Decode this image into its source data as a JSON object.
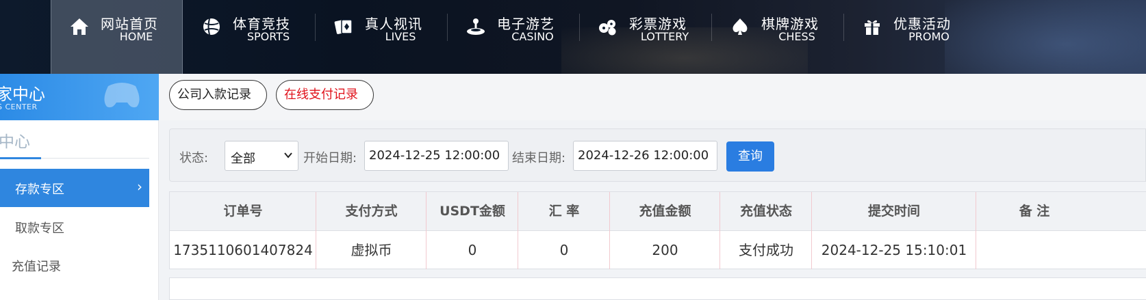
{
  "nav": [
    {
      "cn": "网站首页",
      "en": "HOME",
      "icon": "home-icon"
    },
    {
      "cn": "体育竞技",
      "en": "SPORTS",
      "icon": "ball-icon"
    },
    {
      "cn": "真人视讯",
      "en": "LIVES",
      "icon": "cards-icon"
    },
    {
      "cn": "电子游艺",
      "en": "CASINO",
      "icon": "joystick-icon"
    },
    {
      "cn": "彩票游戏",
      "en": "LOTTERY",
      "icon": "lottery-balls-icon"
    },
    {
      "cn": "棋牌游戏",
      "en": "CHESS",
      "icon": "spade-icon"
    },
    {
      "cn": "优惠活动",
      "en": "PROMO",
      "icon": "gift-icon"
    }
  ],
  "sidebar": {
    "banner_title": "家中心",
    "banner_sub": "S CENTER",
    "section_title": "中心",
    "items": [
      {
        "label": "存款专区"
      },
      {
        "label": "取款专区"
      },
      {
        "label": "充值记录"
      }
    ]
  },
  "tabs": [
    {
      "label": "公司入款记录"
    },
    {
      "label": "在线支付记录"
    }
  ],
  "filter": {
    "status_label": "状态:",
    "status_value": "全部",
    "start_label": "开始日期:",
    "start_value": "2024-12-25 12:00:00",
    "end_label": "结束日期:",
    "end_value": "2024-12-26 12:00:00",
    "query_label": "查询"
  },
  "table": {
    "headers": [
      "订单号",
      "支付方式",
      "USDT金额",
      "汇 率",
      "充值金额",
      "充值状态",
      "提交时间",
      "备 注"
    ],
    "rows": [
      [
        "1735110601407824",
        "虚拟币",
        "0",
        "0",
        "200",
        "支付成功",
        "2024-12-25 15:10:01",
        ""
      ]
    ]
  },
  "colors": {
    "accent": "#2f86df",
    "active_tab_text": "#e0121b",
    "query_button": "#2a7de1"
  }
}
